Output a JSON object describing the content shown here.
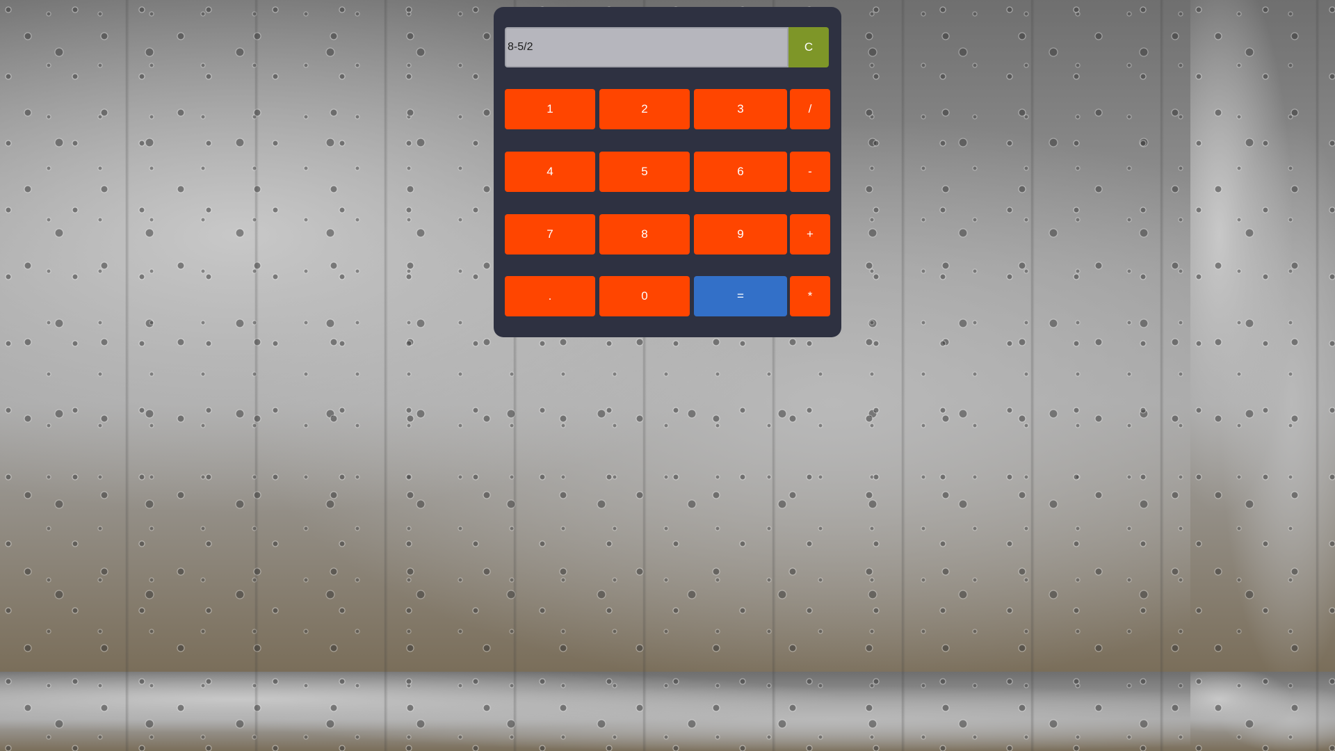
{
  "background": {
    "description_icon": "rain-on-glass"
  },
  "calculator": {
    "display_value": "8-5/2",
    "clear_label": "C",
    "keys": {
      "k1": "1",
      "k2": "2",
      "k3": "3",
      "divide": "/",
      "k4": "4",
      "k5": "5",
      "k6": "6",
      "minus": "-",
      "k7": "7",
      "k8": "8",
      "k9": "9",
      "plus": "+",
      "dot": ".",
      "k0": "0",
      "equals": "=",
      "multiply": "*"
    },
    "colors": {
      "panel": "#2e3141",
      "key": "#ff4500",
      "equals": "#3370c8",
      "clear": "#7e9628",
      "display": "#b6b6bd"
    }
  }
}
